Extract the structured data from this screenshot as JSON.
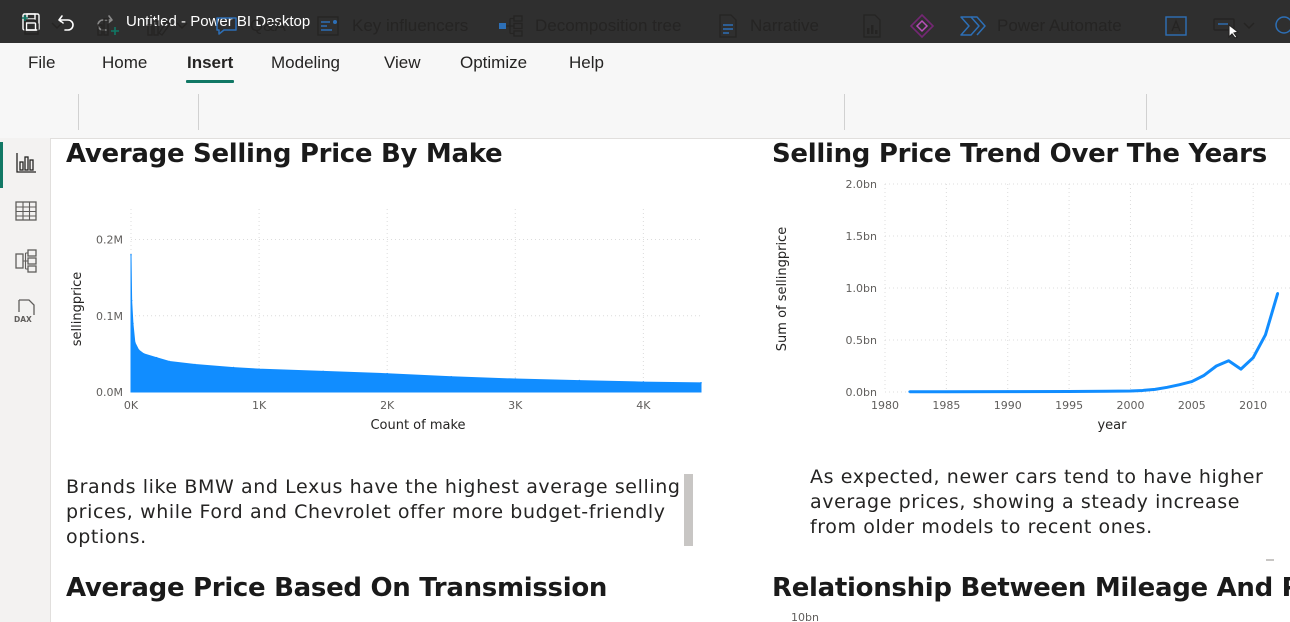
{
  "window": {
    "title": "Untitled - Power BI Desktop"
  },
  "menu": {
    "items": [
      "File",
      "Home",
      "Insert",
      "Modeling",
      "View",
      "Optimize",
      "Help"
    ],
    "active": "Insert"
  },
  "ribbon": {
    "qa": "Q&A",
    "key_influencers": "Key influencers",
    "decomposition_tree": "Decomposition tree",
    "narrative": "Narrative",
    "power_automate": "Power Automate"
  },
  "leftnav": {
    "icons": [
      "report-view-icon",
      "table-view-icon",
      "model-view-icon",
      "dax-query-icon"
    ],
    "dax_label": "DAX"
  },
  "visuals": {
    "make": {
      "title": "Average Selling Price By Make",
      "description": "Brands like BMW and Lexus have the highest average selling prices, while Ford and Chevrolet offer more budget-friendly options."
    },
    "trend": {
      "title": "Selling Price Trend Over The Years",
      "description": "As expected, newer cars tend to have higher average prices, showing a steady increase from older models to recent ones."
    },
    "transmission": {
      "title": "Average Price Based On Transmission"
    },
    "mileage": {
      "title": "Relationship Between Mileage And Price",
      "ytick_top": "10bn"
    }
  },
  "colors": {
    "series": "#118DFF",
    "accent": "#117865",
    "titlebar": "#2F2F2F"
  },
  "chart_data": [
    {
      "type": "area",
      "xlabel": "Count of make",
      "ylabel": "sellingprice",
      "x_ticks": [
        "0K",
        "1K",
        "2K",
        "3K",
        "4K"
      ],
      "y_ticks": [
        "0.0M",
        "0.1M",
        "0.2M"
      ],
      "xlim": [
        0,
        4450
      ],
      "ylim": [
        0,
        0.24
      ],
      "x": [
        0,
        5,
        15,
        30,
        60,
        100,
        200,
        300,
        500,
        800,
        1000,
        1500,
        2000,
        2500,
        3000,
        3500,
        4000,
        4450
      ],
      "values": [
        0.18,
        0.12,
        0.09,
        0.065,
        0.055,
        0.05,
        0.045,
        0.04,
        0.036,
        0.032,
        0.03,
        0.027,
        0.024,
        0.02,
        0.017,
        0.015,
        0.013,
        0.012
      ],
      "grid": true
    },
    {
      "type": "line",
      "xlabel": "year",
      "ylabel": "Sum of sellingprice",
      "x_ticks": [
        "1980",
        "1985",
        "1990",
        "1995",
        "2000",
        "2005",
        "2010"
      ],
      "y_ticks": [
        "0.0bn",
        "0.5bn",
        "1.0bn",
        "1.5bn",
        "2.0bn"
      ],
      "xlim": [
        1980,
        2013
      ],
      "ylim": [
        0,
        2.0
      ],
      "x": [
        1982,
        1985,
        1990,
        1995,
        1998,
        2000,
        2001,
        2002,
        2003,
        2004,
        2005,
        2006,
        2007,
        2008,
        2009,
        2010,
        2011,
        2012
      ],
      "values": [
        0.003,
        0.003,
        0.004,
        0.005,
        0.007,
        0.01,
        0.015,
        0.025,
        0.045,
        0.07,
        0.1,
        0.16,
        0.25,
        0.3,
        0.22,
        0.33,
        0.55,
        0.95
      ],
      "grid": true
    }
  ]
}
